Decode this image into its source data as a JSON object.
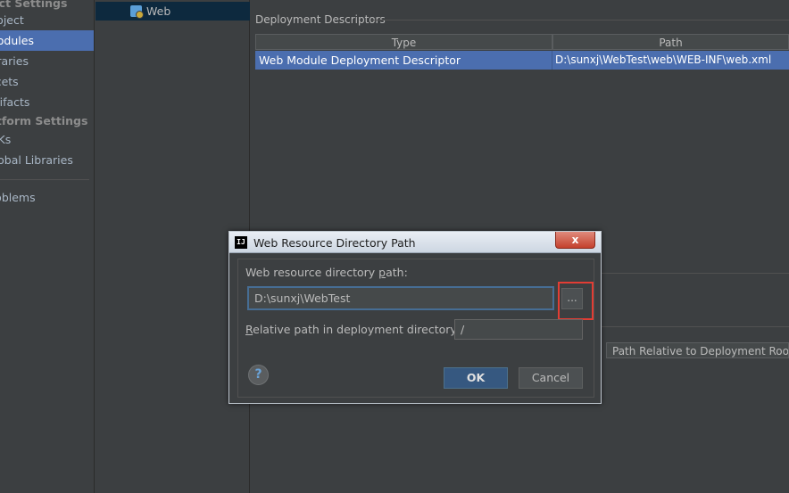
{
  "left_nav": {
    "items": [
      {
        "label": "Project Settings",
        "type": "header"
      },
      {
        "label": "Project",
        "type": "item"
      },
      {
        "label": "Modules",
        "type": "selected"
      },
      {
        "label": "Libraries",
        "type": "item"
      },
      {
        "label": "Facets",
        "type": "item"
      },
      {
        "label": "Artifacts",
        "type": "item"
      },
      {
        "label": "Platform Settings",
        "type": "header"
      },
      {
        "label": "SDKs",
        "type": "item"
      },
      {
        "label": "Global Libraries",
        "type": "item"
      },
      {
        "label": "Problems",
        "type": "item"
      }
    ]
  },
  "tree": {
    "selected_label": "Web",
    "icon": "web-facet-icon"
  },
  "deployment": {
    "section_title": "Deployment Descriptors",
    "columns": [
      "Type",
      "Path"
    ],
    "rows": [
      {
        "type": "Web Module Deployment Descriptor",
        "path": "D:\\sunxj\\WebTest\\web\\WEB-INF\\web.xml"
      }
    ],
    "resource_column_header": "Path Relative to Deployment Root"
  },
  "dialog": {
    "title": "Web Resource Directory Path",
    "close_label": "x",
    "path_label_pre": "Web resource directory ",
    "path_label_mn": "p",
    "path_label_post": "ath:",
    "path_value": "D:\\sunxj\\WebTest",
    "browse_label": "...",
    "relative_label_mn": "R",
    "relative_label_post": "elative path in deployment directory:",
    "relative_value": "/",
    "help_label": "?",
    "ok_label": "OK",
    "cancel_label": "Cancel"
  },
  "colors": {
    "selection": "#4b6eaf",
    "highlight": "#e23d34",
    "ok_button": "#365880"
  }
}
